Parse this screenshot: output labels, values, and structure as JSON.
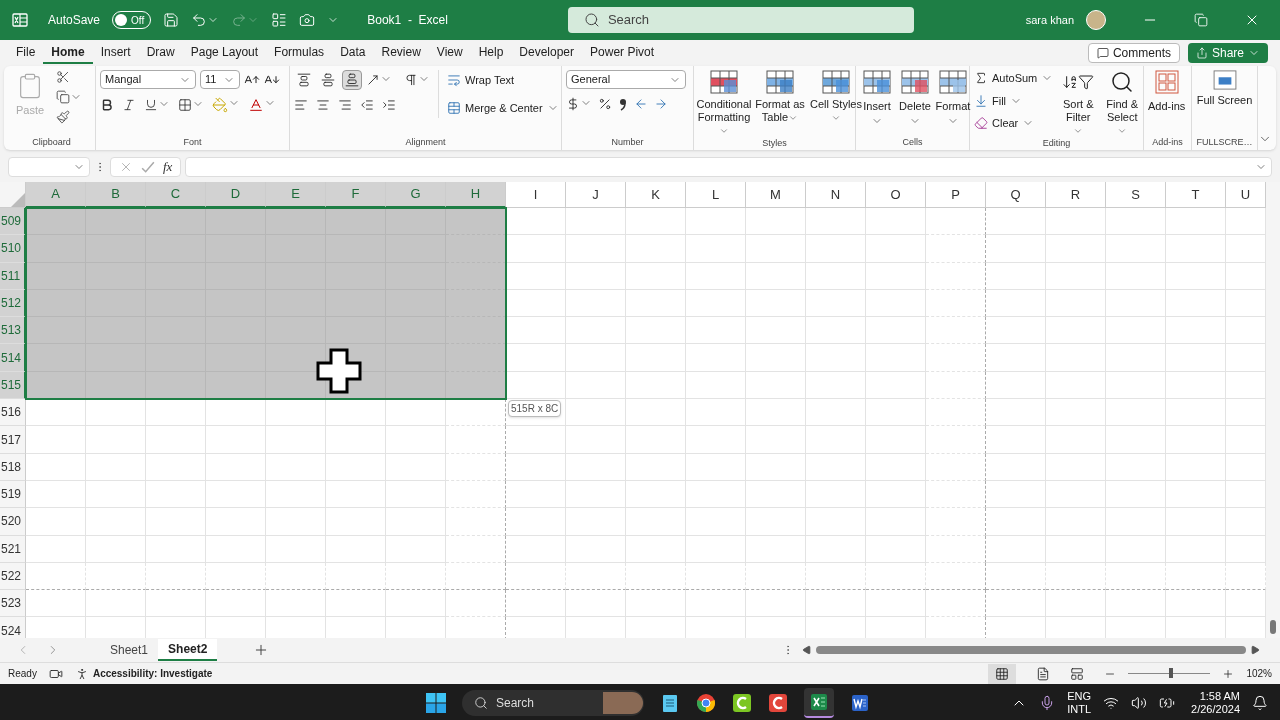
{
  "title_bar": {
    "autosave_label": "AutoSave",
    "autosave": {
      "on": false,
      "label": "Off"
    },
    "redo_disabled": true,
    "document_title": "Book1  -  Excel",
    "search_placeholder": "Search",
    "user_name": "sara khan"
  },
  "menu_tabs": [
    {
      "label": "File",
      "selected": false
    },
    {
      "label": "Home",
      "selected": true
    },
    {
      "label": "Insert",
      "selected": false
    },
    {
      "label": "Draw",
      "selected": false
    },
    {
      "label": "Page Layout",
      "selected": false
    },
    {
      "label": "Formulas",
      "selected": false
    },
    {
      "label": "Data",
      "selected": false
    },
    {
      "label": "Review",
      "selected": false
    },
    {
      "label": "View",
      "selected": false
    },
    {
      "label": "Help",
      "selected": false
    },
    {
      "label": "Developer",
      "selected": false
    },
    {
      "label": "Power Pivot",
      "selected": false
    }
  ],
  "comments_label": "Comments",
  "share_label": "Share",
  "ribbon": {
    "clipboard": {
      "paste": "Paste",
      "paste_disabled": true,
      "label": "Clipboard"
    },
    "font": {
      "font_name": "Mangal",
      "font_size": "11",
      "label": "Font"
    },
    "alignment": {
      "vertical_align": [
        {
          "selected": false
        },
        {
          "selected": false
        },
        {
          "selected": true
        }
      ],
      "wrap_text": "Wrap Text",
      "merge_center": "Merge & Center",
      "label": "Alignment"
    },
    "number": {
      "format": "General",
      "label": "Number"
    },
    "styles": {
      "buttons": [
        "Conditional Formatting",
        "Format as Table",
        "Cell Styles"
      ],
      "label": "Styles"
    },
    "cells": {
      "buttons": [
        "Insert",
        "Delete",
        "Format"
      ],
      "label": "Cells"
    },
    "editing": {
      "autosum": "AutoSum",
      "fill": "Fill",
      "clear": "Clear",
      "sort_filter": "Sort & Filter",
      "find_select": "Find & Select",
      "label": "Editing"
    },
    "addins": {
      "button": "Add-ins",
      "label": "Add-ins"
    },
    "fullscreen": {
      "button": "Full Screen",
      "label": "FULLSCRE…"
    }
  },
  "formula_bar": {
    "fx_label": "fx"
  },
  "grid": {
    "columns": [
      {
        "label": "A",
        "selected": true
      },
      {
        "label": "B",
        "selected": true
      },
      {
        "label": "C",
        "selected": true
      },
      {
        "label": "D",
        "selected": true
      },
      {
        "label": "E",
        "selected": true
      },
      {
        "label": "F",
        "selected": true
      },
      {
        "label": "G",
        "selected": true
      },
      {
        "label": "H",
        "selected": true,
        "page_break": true
      },
      {
        "label": "I",
        "selected": false
      },
      {
        "label": "J",
        "selected": false
      },
      {
        "label": "K",
        "selected": false
      },
      {
        "label": "L",
        "selected": false
      },
      {
        "label": "M",
        "selected": false
      },
      {
        "label": "N",
        "selected": false
      },
      {
        "label": "O",
        "selected": false
      },
      {
        "label": "P",
        "selected": false,
        "page_break": true
      },
      {
        "label": "Q",
        "selected": false
      },
      {
        "label": "R",
        "selected": false
      },
      {
        "label": "S",
        "selected": false
      },
      {
        "label": "T",
        "selected": false
      },
      {
        "label": "U",
        "selected": false
      }
    ],
    "rows": [
      {
        "label": "509",
        "selected": true
      },
      {
        "label": "510",
        "selected": true
      },
      {
        "label": "511",
        "selected": true
      },
      {
        "label": "512",
        "selected": true
      },
      {
        "label": "513",
        "selected": true
      },
      {
        "label": "514",
        "selected": true
      },
      {
        "label": "515",
        "selected": true
      },
      {
        "label": "516",
        "selected": false
      },
      {
        "label": "517",
        "selected": false
      },
      {
        "label": "518",
        "selected": false
      },
      {
        "label": "519",
        "selected": false
      },
      {
        "label": "520",
        "selected": false
      },
      {
        "label": "521",
        "selected": false
      },
      {
        "label": "522",
        "selected": false,
        "page_break": true
      },
      {
        "label": "523",
        "selected": false
      },
      {
        "label": "524",
        "selected": false
      }
    ],
    "selection_size": "515R x 8C"
  },
  "sheet_tabs": [
    {
      "label": "Sheet1",
      "selected": false
    },
    {
      "label": "Sheet2",
      "selected": true
    }
  ],
  "status_bar": {
    "status": "Ready",
    "accessibility": "Accessibility: Investigate",
    "zoom": {
      "level": 0.52,
      "label": "102%"
    }
  },
  "taskbar": {
    "search_placeholder": "Search",
    "language": "ENG",
    "layout": "INTL",
    "time": "1:58 AM",
    "date": "2/26/2024"
  }
}
